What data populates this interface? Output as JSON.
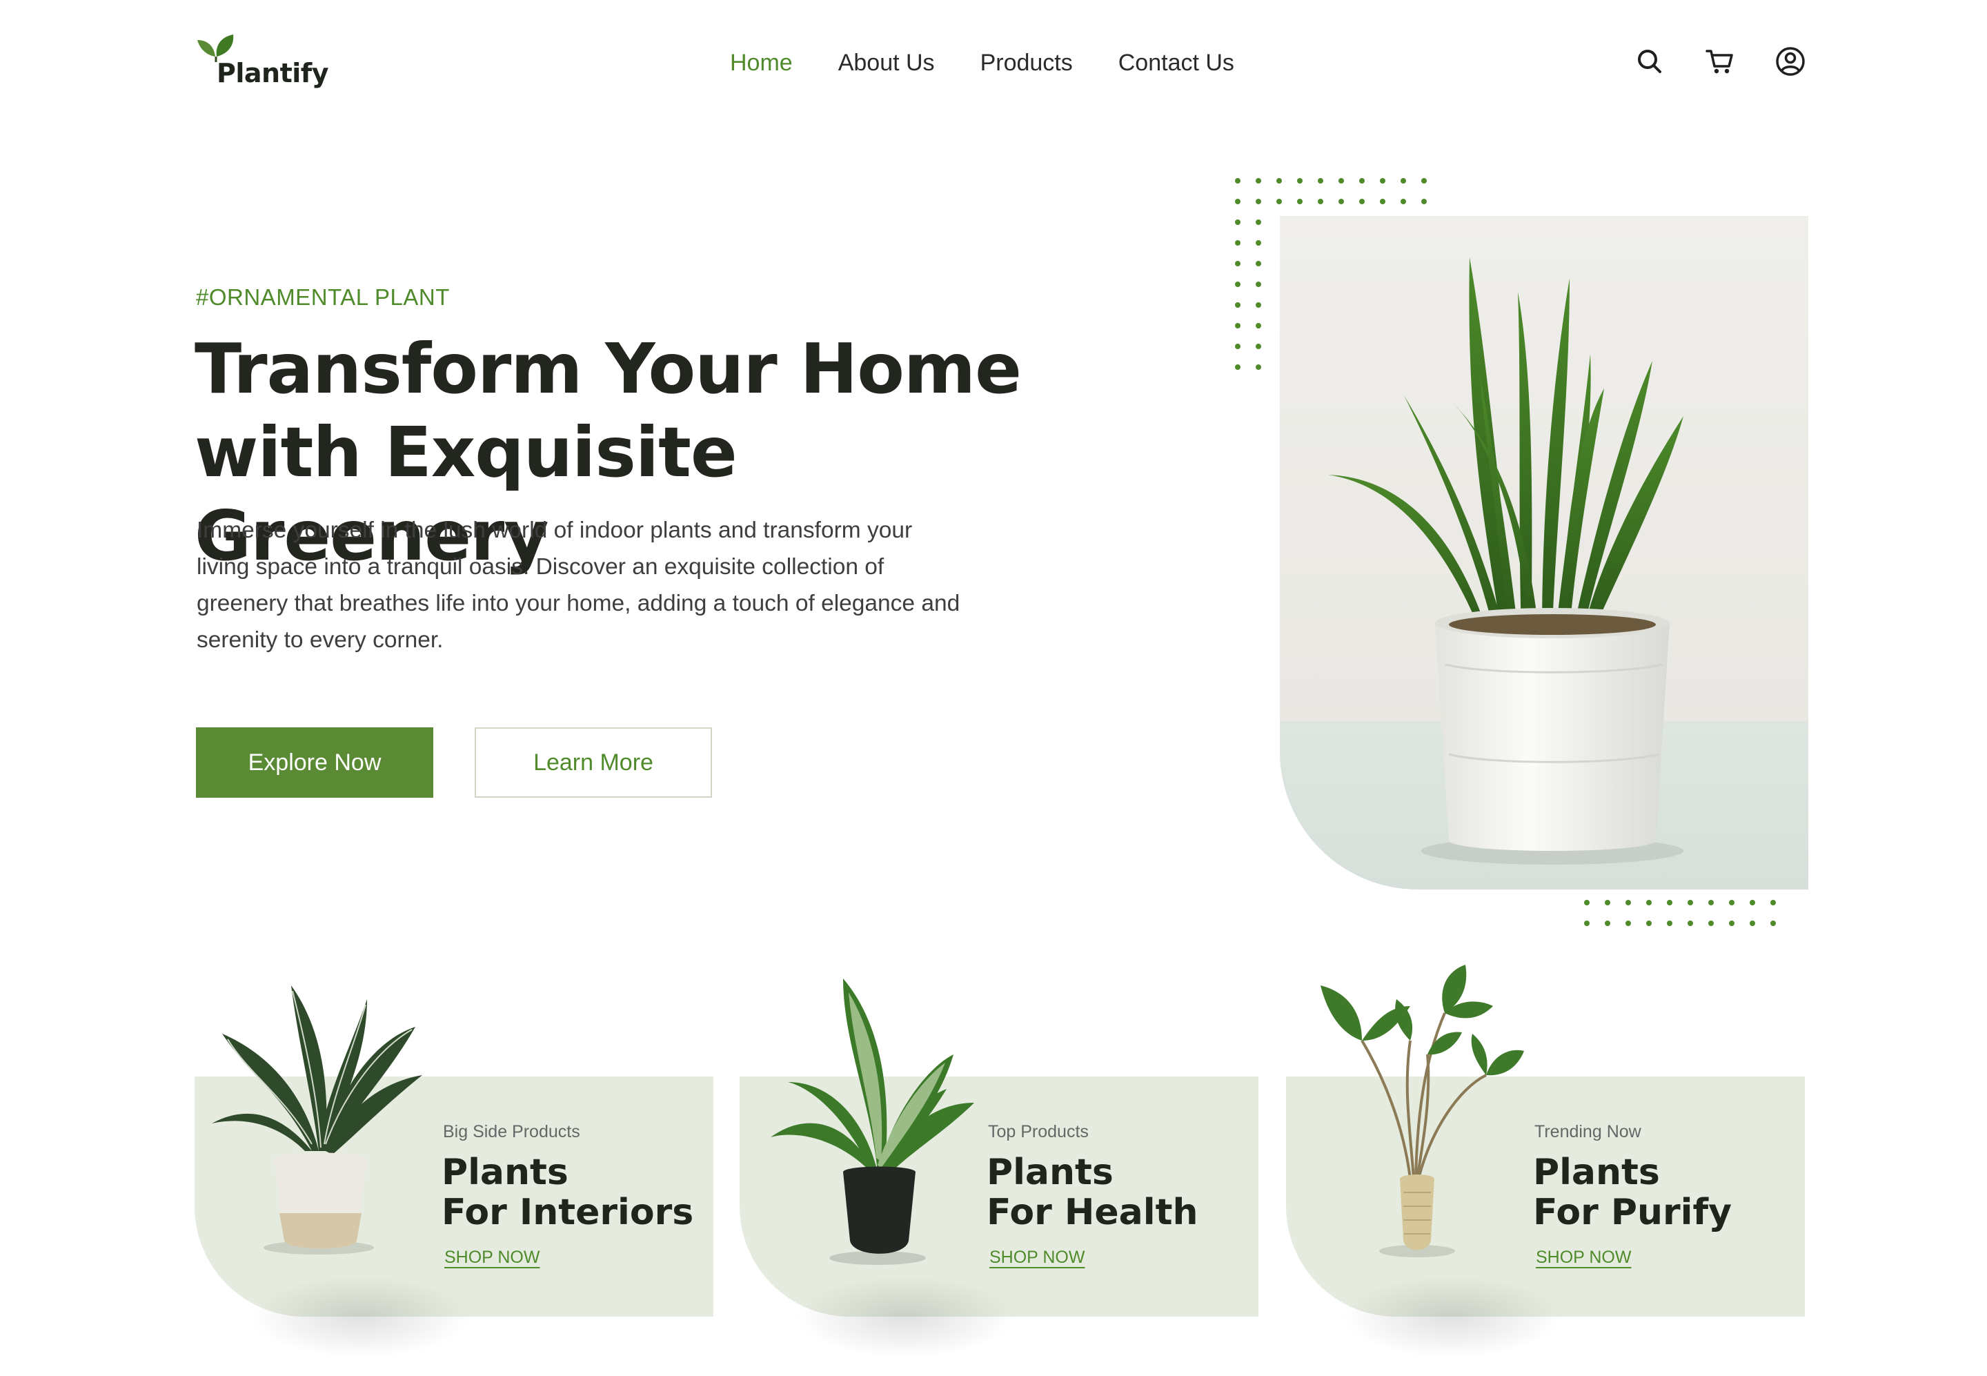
{
  "brand": {
    "name": "Plantify",
    "logo_icon": "leaf-logo-icon"
  },
  "nav": {
    "items": [
      {
        "label": "Home",
        "active": true
      },
      {
        "label": "About Us",
        "active": false
      },
      {
        "label": "Products",
        "active": false
      },
      {
        "label": "Contact Us",
        "active": false
      }
    ],
    "icons": [
      "search-icon",
      "cart-icon",
      "user-icon"
    ]
  },
  "hero": {
    "tag": "#ORNAMENTAL PLANT",
    "headline_line1": "Transform Your Home",
    "headline_line2": "with Exquisite Greenery",
    "description": "Immerse yourself in the lush world of indoor plants and transform your living space into a tranquil oasis. Discover an exquisite collection of greenery that breathes life into your home, adding a touch of elegance and serenity to every corner.",
    "primary_button": "Explore Now",
    "secondary_button": "Learn More"
  },
  "cards": [
    {
      "kicker": "Big Side Products",
      "title_line1": "Plants",
      "title_line2": "For Interiors",
      "link": "SHOP NOW"
    },
    {
      "kicker": "Top Products",
      "title_line1": "Plants",
      "title_line2": "For Health",
      "link": "SHOP NOW"
    },
    {
      "kicker": "Trending Now",
      "title_line1": "Plants",
      "title_line2": "For Purify",
      "link": "SHOP NOW"
    }
  ],
  "colors": {
    "accent": "#5a8a33",
    "accent_text": "#4f8a2b",
    "card_bg": "#e5ecdf",
    "heading": "#22261f"
  }
}
